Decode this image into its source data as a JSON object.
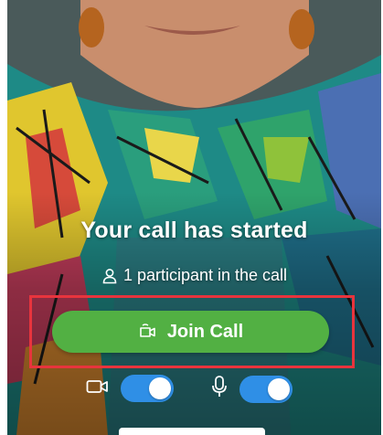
{
  "call": {
    "title": "Your call has started",
    "participants_text": "1 participant in the call"
  },
  "join_button": {
    "label": "Join Call",
    "color": "#52b043"
  },
  "toggles": {
    "video": {
      "icon": "video-camera-icon",
      "state": "on",
      "color": "#2f8fe6"
    },
    "microphone": {
      "icon": "microphone-icon",
      "state": "on",
      "color": "#2f8fe6"
    }
  },
  "highlight": {
    "color": "#e8343d"
  },
  "icons": {
    "participant": "person-icon",
    "join": "video-call-icon"
  }
}
